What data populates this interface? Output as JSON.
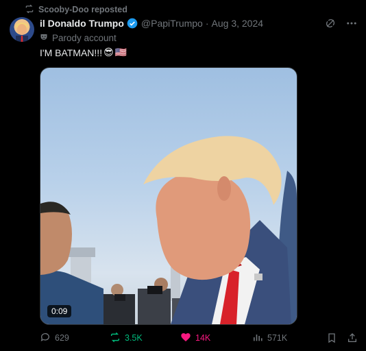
{
  "repost_banner": {
    "text": "Scooby-Doo reposted"
  },
  "author": {
    "display_name": "il Donaldo Trumpo",
    "handle": "@PapiTrumpo",
    "separator": "·",
    "date": "Aug 3, 2024",
    "label": "Parody account"
  },
  "tweet": {
    "text": "I'M BATMAN!!!",
    "emoji": [
      "😎",
      "🇺🇸"
    ]
  },
  "media": {
    "duration": "0:09"
  },
  "actions": {
    "replies": "629",
    "reposts": "3.5K",
    "likes": "14K",
    "views": "571K"
  },
  "colors": {
    "background": "#000000",
    "text_primary": "#e7e9ea",
    "text_secondary": "#71767b",
    "verified": "#1d9bf0",
    "repost_active": "#00ba7c",
    "like_active": "#f91880"
  },
  "icons": [
    "repost-icon",
    "verified-badge-icon",
    "grok-icon",
    "more-icon",
    "parody-mask-icon",
    "reply-icon",
    "like-icon",
    "views-icon",
    "bookmark-icon",
    "share-icon"
  ]
}
